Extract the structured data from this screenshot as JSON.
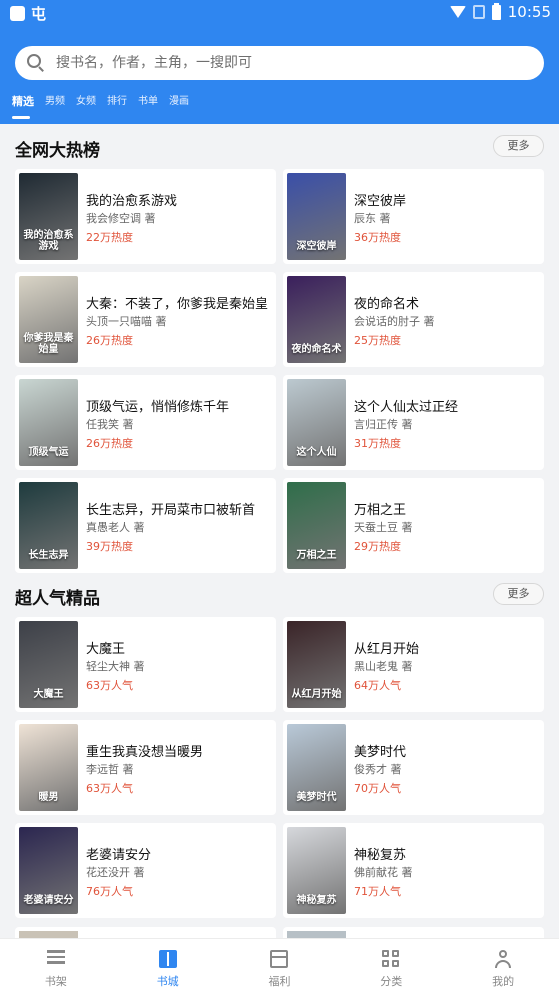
{
  "status_bar": {
    "app_badge": "屯",
    "time": "10:55"
  },
  "search": {
    "placeholder": "搜书名，作者，主角，一搜即可"
  },
  "tabs": [
    {
      "label": "精选",
      "active": true
    },
    {
      "label": "男频"
    },
    {
      "label": "女频"
    },
    {
      "label": "排行"
    },
    {
      "label": "书单"
    },
    {
      "label": "漫画"
    }
  ],
  "sections": [
    {
      "title": "全网大热榜",
      "more_label": "更多",
      "books": [
        {
          "title": "我的治愈系游戏",
          "author": "我会修空调 著",
          "heat": "22万热度",
          "cover_text": "我的治愈系游戏",
          "cover_color": "#1f2a33"
        },
        {
          "title": "深空彼岸",
          "author": "辰东 著",
          "heat": "36万热度",
          "cover_text": "深空彼岸",
          "cover_color": "#3a4fa8"
        },
        {
          "title": "大秦：不装了，你爹我是秦始皇",
          "author": "头顶一只喵喵 著",
          "heat": "26万热度",
          "cover_text": "你爹我是秦始皇",
          "cover_color": "#d9d4c6"
        },
        {
          "title": "夜的命名术",
          "author": "会说话的肘子 著",
          "heat": "25万热度",
          "cover_text": "夜的命名术",
          "cover_color": "#3a1f5c"
        },
        {
          "title": "顶级气运，悄悄修炼千年",
          "author": "任我笑 著",
          "heat": "26万热度",
          "cover_text": "顶级气运",
          "cover_color": "#c9d6d2"
        },
        {
          "title": "这个人仙太过正经",
          "author": "言归正传 著",
          "heat": "31万热度",
          "cover_text": "这个人仙",
          "cover_color": "#bcc9d0"
        },
        {
          "title": "长生志异，开局菜市口被斩首",
          "author": "真愚老人 著",
          "heat": "39万热度",
          "cover_text": "长生志异",
          "cover_color": "#1e3b3e"
        },
        {
          "title": "万相之王",
          "author": "天蚕土豆 著",
          "heat": "29万热度",
          "cover_text": "万相之王",
          "cover_color": "#2f6e4a"
        }
      ]
    },
    {
      "title": "超人气精品",
      "more_label": "更多",
      "books": [
        {
          "title": "大魔王",
          "author": "轻尘大神 著",
          "heat": "63万人气",
          "cover_text": "大魔王",
          "cover_color": "#3d4048"
        },
        {
          "title": "从红月开始",
          "author": "黑山老鬼 著",
          "heat": "64万人气",
          "cover_text": "从红月开始",
          "cover_color": "#3a2428"
        },
        {
          "title": "重生我真没想当暖男",
          "author": "李远哲 著",
          "heat": "63万人气",
          "cover_text": "暖男",
          "cover_color": "#efe3d6"
        },
        {
          "title": "美梦时代",
          "author": "俊秀才 著",
          "heat": "70万人气",
          "cover_text": "美梦时代",
          "cover_color": "#b9c9d8"
        },
        {
          "title": "老婆请安分",
          "author": "花还没开 著",
          "heat": "76万人气",
          "cover_text": "老婆请安分",
          "cover_color": "#2b2650"
        },
        {
          "title": "神秘复苏",
          "author": "佛前献花 著",
          "heat": "71万人气",
          "cover_text": "神秘复苏",
          "cover_color": "#d6d8dc"
        }
      ]
    }
  ],
  "bottom_nav": [
    {
      "label": "书架",
      "icon": "bookshelf-icon"
    },
    {
      "label": "书城",
      "icon": "book-icon",
      "active": true
    },
    {
      "label": "福利",
      "icon": "gift-icon"
    },
    {
      "label": "分类",
      "icon": "grid-icon"
    },
    {
      "label": "我的",
      "icon": "user-icon"
    }
  ]
}
